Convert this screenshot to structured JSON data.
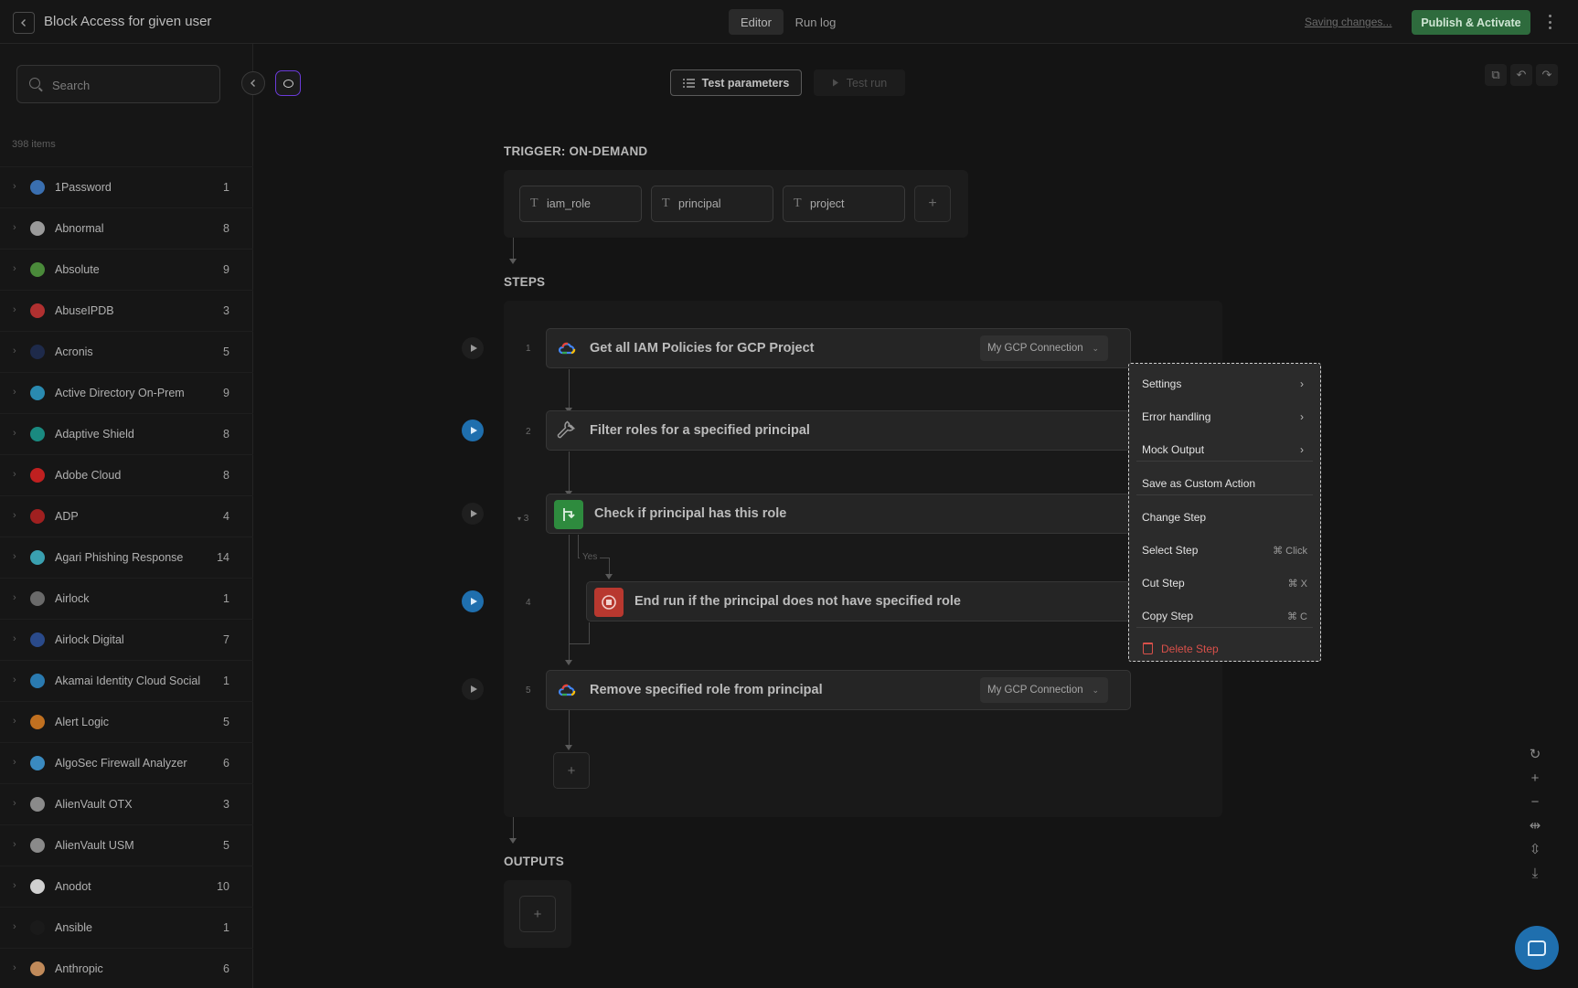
{
  "header": {
    "title": "Block Access for given user",
    "tabs": [
      "Editor",
      "Run log"
    ],
    "saving": "Saving changes...",
    "publish": "Publish & Activate"
  },
  "sidebar": {
    "search_placeholder": "Search",
    "item_count": "398 items",
    "items": [
      {
        "name": "1Password",
        "count": "1",
        "color": "#3a6fb0"
      },
      {
        "name": "Abnormal",
        "count": "8",
        "color": "#9a9a9a"
      },
      {
        "name": "Absolute",
        "count": "9",
        "color": "#4a8a3a"
      },
      {
        "name": "AbuseIPDB",
        "count": "3",
        "color": "#b03030"
      },
      {
        "name": "Acronis",
        "count": "5",
        "color": "#1e2a4a"
      },
      {
        "name": "Active Directory On-Prem",
        "count": "9",
        "color": "#2a8ab0"
      },
      {
        "name": "Adaptive Shield",
        "count": "8",
        "color": "#1a8a80"
      },
      {
        "name": "Adobe Cloud",
        "count": "8",
        "color": "#c02020"
      },
      {
        "name": "ADP",
        "count": "4",
        "color": "#a02020"
      },
      {
        "name": "Agari Phishing Response",
        "count": "14",
        "color": "#3aa0b0"
      },
      {
        "name": "Airlock",
        "count": "1",
        "color": "#6a6a6a"
      },
      {
        "name": "Airlock Digital",
        "count": "7",
        "color": "#2a4a8a"
      },
      {
        "name": "Akamai Identity Cloud Social",
        "count": "1",
        "color": "#2a7ab0"
      },
      {
        "name": "Alert Logic",
        "count": "5",
        "color": "#c07020"
      },
      {
        "name": "AlgoSec Firewall Analyzer",
        "count": "6",
        "color": "#3a8ac0"
      },
      {
        "name": "AlienVault OTX",
        "count": "3",
        "color": "#8a8a8a"
      },
      {
        "name": "AlienVault USM",
        "count": "5",
        "color": "#8a8a8a"
      },
      {
        "name": "Anodot",
        "count": "10",
        "color": "#d0d0d0"
      },
      {
        "name": "Ansible",
        "count": "1",
        "color": "#1a1a1a"
      },
      {
        "name": "Anthropic",
        "count": "6",
        "color": "#c08a5a"
      }
    ]
  },
  "toolbar": {
    "test_parameters": "Test parameters",
    "test_run": "Test run"
  },
  "trigger": {
    "label": "TRIGGER: ON-DEMAND",
    "params": [
      "iam_role",
      "principal",
      "project"
    ]
  },
  "steps": {
    "label": "STEPS",
    "items": [
      {
        "num": "1",
        "title": "Get all IAM Policies for GCP Project",
        "connection": "My GCP Connection"
      },
      {
        "num": "2",
        "title": "Filter roles for a specified principal"
      },
      {
        "num": "3",
        "title": "Check if principal has this role"
      },
      {
        "num": "4",
        "title": "End run if the principal does not have specified role"
      },
      {
        "num": "5",
        "title": "Remove specified role from principal",
        "connection": "My GCP Connection"
      }
    ],
    "branch_label": "Yes"
  },
  "outputs": {
    "label": "OUTPUTS"
  },
  "context_menu": {
    "settings": "Settings",
    "error_handling": "Error handling",
    "mock_output": "Mock Output",
    "save_custom": "Save as Custom Action",
    "change_step": "Change Step",
    "select_step": "Select Step",
    "select_kbd": "⌘ Click",
    "cut_step": "Cut Step",
    "cut_kbd": "⌘ X",
    "copy_step": "Copy Step",
    "copy_kbd": "⌘ C",
    "delete_step": "Delete Step"
  }
}
